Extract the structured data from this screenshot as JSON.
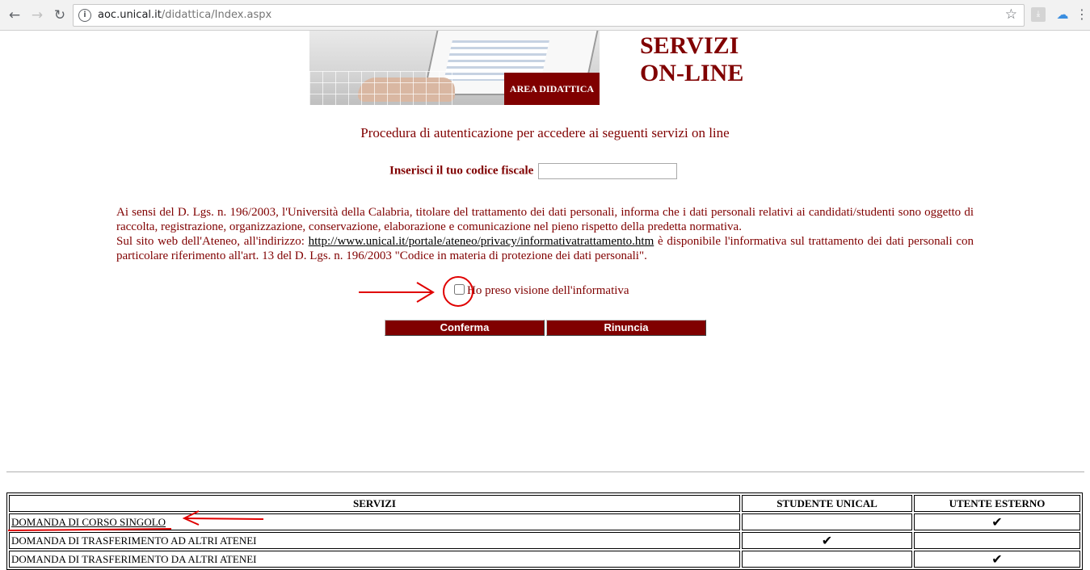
{
  "browser": {
    "url_host": "aoc.unical.it",
    "url_path": "/didattica/Index.aspx",
    "back_icon": "arrow-left-icon",
    "forward_icon": "arrow-right-icon",
    "reload_icon": "reload-icon",
    "info_icon": "info-icon",
    "star_icon": "star-icon",
    "info_glyph": "i",
    "star_glyph": "☆",
    "back_glyph": "←",
    "forward_glyph": "→",
    "reload_glyph": "↻",
    "pdf_glyph": "⤓",
    "cloud_glyph": "☁",
    "menu_glyph": "⋮"
  },
  "header": {
    "banner_label": "AREA DIDATTICA",
    "title_line1": "SERVIZI",
    "title_line2": "ON-LINE"
  },
  "form": {
    "subtitle": "Procedura di autenticazione per accedere ai seguenti servizi on line",
    "codice_fiscale_label": "Inserisci il tuo codice fiscale",
    "codice_fiscale_value": "",
    "privacy_text_1": "Ai sensi del D. Lgs. n. 196/2003, l'Università della Calabria, titolare del trattamento dei dati personali, informa che i dati personali relativi ai candidati/studenti sono oggetto di raccolta, registrazione, organizzazione, conservazione, elaborazione e comunicazione nel pieno rispetto della predetta normativa.",
    "privacy_text_2_prefix": "Sul sito web dell'Ateneo, all'indirizzo: ",
    "privacy_link": "http://www.unical.it/portale/ateneo/privacy/informativatrattamento.htm",
    "privacy_text_2_suffix": " è disponibile l'informativa sul trattamento dei dati personali con particolare riferimento all'art. 13 del D. Lgs. n. 196/2003 \"Codice in materia di protezione dei dati personali\".",
    "consent_label": "Ho preso visione dell'informativa",
    "consent_checked": false,
    "confirm_label": "Conferma",
    "cancel_label": "Rinuncia"
  },
  "services_table": {
    "headers": [
      "SERVIZI",
      "STUDENTE UNICAL",
      "UTENTE ESTERNO"
    ],
    "check_glyph": "✔",
    "rows": [
      {
        "name": "DOMANDA DI CORSO SINGOLO",
        "studente_unical": false,
        "utente_esterno": true
      },
      {
        "name": "DOMANDA DI TRASFERIMENTO AD ALTRI ATENEI",
        "studente_unical": true,
        "utente_esterno": false
      },
      {
        "name": "DOMANDA DI TRASFERIMENTO DA ALTRI ATENEI",
        "studente_unical": false,
        "utente_esterno": true
      }
    ]
  },
  "annotations": {
    "color": "#e00000"
  },
  "colors": {
    "brand": "#800000",
    "chrome_bg": "#f2f2f2"
  }
}
